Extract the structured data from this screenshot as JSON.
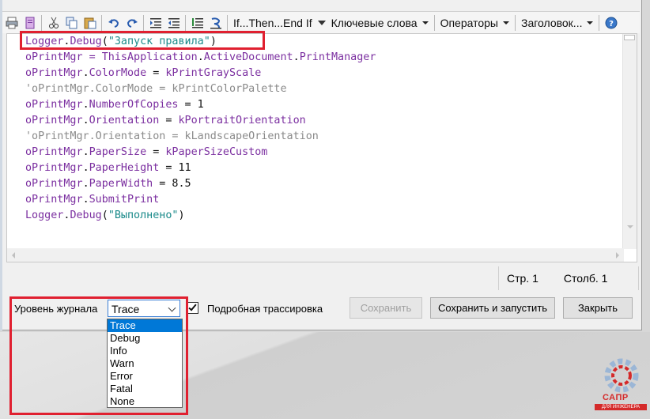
{
  "toolbar": {
    "menus": [
      {
        "label": "If...Then...End If",
        "has_dropdown": false
      },
      {
        "label": "Ключевые слова",
        "has_dropdown": true
      },
      {
        "label": "Операторы",
        "has_dropdown": true
      },
      {
        "label": "Заголовок...",
        "has_dropdown": true
      }
    ]
  },
  "editor": {
    "lines": [
      {
        "segments": [
          {
            "t": "Logger",
            "k": "id"
          },
          {
            "t": ".",
            "k": "plain"
          },
          {
            "t": "Debug",
            "k": "id"
          },
          {
            "t": "(",
            "k": "plain"
          },
          {
            "t": "\"Запуск правила\"",
            "k": "str"
          },
          {
            "t": ")",
            "k": "plain"
          }
        ]
      },
      {
        "segments": [
          {
            "t": "oPrintMgr = ",
            "k": "id"
          },
          {
            "t": "ThisApplication",
            "k": "id"
          },
          {
            "t": ".",
            "k": "plain"
          },
          {
            "t": "ActiveDocument",
            "k": "id"
          },
          {
            "t": ".",
            "k": "plain"
          },
          {
            "t": "PrintManager",
            "k": "id"
          }
        ]
      },
      {
        "segments": [
          {
            "t": "oPrintMgr",
            "k": "id"
          },
          {
            "t": ".",
            "k": "plain"
          },
          {
            "t": "ColorMode",
            "k": "id"
          },
          {
            "t": " = ",
            "k": "plain"
          },
          {
            "t": "kPrintGrayScale",
            "k": "id"
          }
        ]
      },
      {
        "segments": [
          {
            "t": "'oPrintMgr.ColorMode = kPrintColorPalette",
            "k": "comment"
          }
        ]
      },
      {
        "segments": [
          {
            "t": "oPrintMgr",
            "k": "id"
          },
          {
            "t": ".",
            "k": "plain"
          },
          {
            "t": "NumberOfCopies",
            "k": "id"
          },
          {
            "t": " = 1",
            "k": "plain"
          }
        ]
      },
      {
        "segments": [
          {
            "t": "oPrintMgr",
            "k": "id"
          },
          {
            "t": ".",
            "k": "plain"
          },
          {
            "t": "Orientation",
            "k": "id"
          },
          {
            "t": " = ",
            "k": "plain"
          },
          {
            "t": "kPortraitOrientation",
            "k": "id"
          }
        ]
      },
      {
        "segments": [
          {
            "t": "'oPrintMgr.Orientation = kLandscapeOrientation",
            "k": "comment"
          }
        ]
      },
      {
        "segments": [
          {
            "t": "oPrintMgr",
            "k": "id"
          },
          {
            "t": ".",
            "k": "plain"
          },
          {
            "t": "PaperSize",
            "k": "id"
          },
          {
            "t": " = ",
            "k": "plain"
          },
          {
            "t": "kPaperSizeCustom",
            "k": "id"
          }
        ]
      },
      {
        "segments": [
          {
            "t": "oPrintMgr",
            "k": "id"
          },
          {
            "t": ".",
            "k": "plain"
          },
          {
            "t": "PaperHeight",
            "k": "id"
          },
          {
            "t": " = 11",
            "k": "plain"
          }
        ]
      },
      {
        "segments": [
          {
            "t": "oPrintMgr",
            "k": "id"
          },
          {
            "t": ".",
            "k": "plain"
          },
          {
            "t": "PaperWidth",
            "k": "id"
          },
          {
            "t": " = 8.5",
            "k": "plain"
          }
        ]
      },
      {
        "segments": [
          {
            "t": "oPrintMgr",
            "k": "id"
          },
          {
            "t": ".",
            "k": "plain"
          },
          {
            "t": "SubmitPrint",
            "k": "id"
          }
        ]
      },
      {
        "segments": [
          {
            "t": "Logger",
            "k": "id"
          },
          {
            "t": ".",
            "k": "plain"
          },
          {
            "t": "Debug",
            "k": "id"
          },
          {
            "t": "(",
            "k": "plain"
          },
          {
            "t": "\"Выполнено\"",
            "k": "str"
          },
          {
            "t": ")",
            "k": "plain"
          }
        ]
      }
    ]
  },
  "status": {
    "line": "Стр. 1",
    "column": "Столб. 1"
  },
  "bottom": {
    "log_level_label": "Уровень журнала",
    "log_level_value": "Trace",
    "verbose_trace_label": "Подробная трассировка",
    "verbose_trace_checked": true,
    "save_label": "Сохранить",
    "save_run_label": "Сохранить и запустить",
    "close_label": "Закрыть"
  },
  "log_levels": [
    "Trace",
    "Debug",
    "Info",
    "Warn",
    "Error",
    "Fatal",
    "None"
  ],
  "log_level_selected_index": 0,
  "logo": {
    "text": "САПР",
    "subtext": "ДЛЯ ИНЖЕНЕРА"
  },
  "colors": {
    "identifier": "#7b2fa0",
    "string": "#1a8a8a",
    "comment": "#8a8a8a",
    "highlight": "#e02030",
    "selection": "#0078d7"
  }
}
